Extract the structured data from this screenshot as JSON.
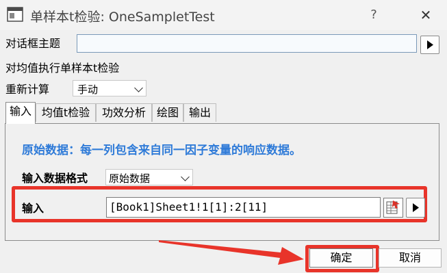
{
  "window": {
    "title": "单样本t检验: OneSampletTest",
    "help": "?",
    "close": "✕"
  },
  "dialog_subject": {
    "label": "对话框主题",
    "value": ""
  },
  "description": "对均值执行单样本t检验",
  "recalculate": {
    "label": "重新计算",
    "value": "手动"
  },
  "tabs": [
    {
      "label": "输入",
      "active": true
    },
    {
      "label": "均值t检验",
      "active": false
    },
    {
      "label": "功效分析",
      "active": false
    },
    {
      "label": "绘图",
      "active": false
    },
    {
      "label": "输出",
      "active": false
    }
  ],
  "input_tab": {
    "raw_data_description": "原始数据：每一列包含来自同一因子变量的响应数据。",
    "format_label": "输入数据格式",
    "format_value": "原始数据",
    "input_label": "输入",
    "input_value": "[Book1]Sheet1!1[1]:2[11]"
  },
  "buttons": {
    "ok": "确定",
    "cancel": "取消"
  },
  "colors": {
    "highlight_red": "#e8342a",
    "description_blue": "#2f7bd8"
  }
}
